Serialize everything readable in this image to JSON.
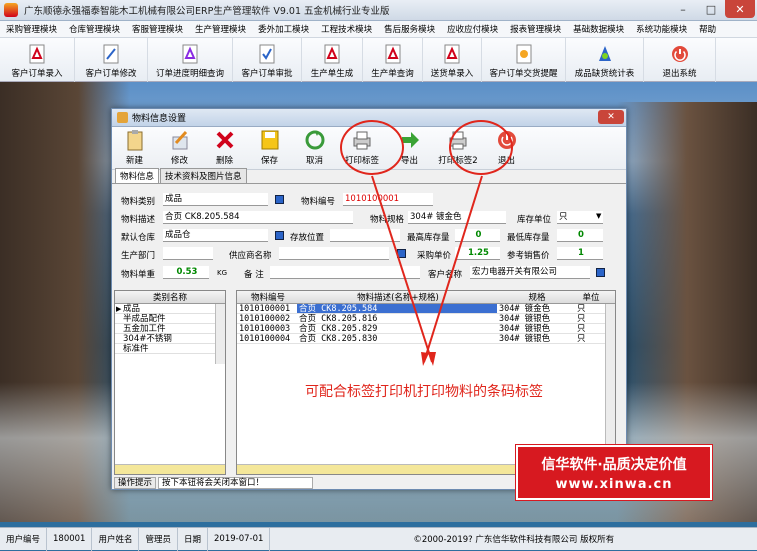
{
  "window": {
    "title": "广东顺德永强福泰智能木工机械有限公司ERP生产管理软件  V9.01 五金机械行业专业版",
    "min": "–",
    "max": "□",
    "close": "✕"
  },
  "menu": [
    "采购管理模块",
    "仓库管理模块",
    "客服管理模块",
    "生产管理模块",
    "委外加工模块",
    "工程技术模块",
    "售后服务模块",
    "应收应付模块",
    "报表管理模块",
    "基础数据模块",
    "系统功能模块",
    "帮助"
  ],
  "toolbar": [
    {
      "label": "客户订单录入",
      "icon": "pdf-icon"
    },
    {
      "label": "客户订单修改",
      "icon": "edit-doc-icon"
    },
    {
      "label": "订单进度明细查询",
      "icon": "pdf-icon"
    },
    {
      "label": "客户订单审批",
      "icon": "approve-icon"
    },
    {
      "label": "生产单生成",
      "icon": "pdf-icon"
    },
    {
      "label": "生产单查询",
      "icon": "pdf-icon"
    },
    {
      "label": "送货单录入",
      "icon": "pdf-icon"
    },
    {
      "label": "客户订单交货提醒",
      "icon": "remind-icon"
    },
    {
      "label": "成品缺货统计表",
      "icon": "stats-icon"
    },
    {
      "label": "退出系统",
      "icon": "exit-icon"
    }
  ],
  "dialog": {
    "title": "物料信息设置",
    "close": "✕",
    "buttons": [
      {
        "label": "新建",
        "icon": "clipboard-icon"
      },
      {
        "label": "修改",
        "icon": "edit-icon"
      },
      {
        "label": "删除",
        "icon": "delete-icon"
      },
      {
        "label": "保存",
        "icon": "save-icon"
      },
      {
        "label": "取消",
        "icon": "cancel-icon"
      },
      {
        "label": "打印标签",
        "icon": "printer-icon"
      },
      {
        "label": "导出",
        "icon": "export-icon"
      },
      {
        "label": "打印标签2",
        "icon": "printer-icon"
      },
      {
        "label": "退出",
        "icon": "exit-icon"
      }
    ],
    "tabs": [
      "物料信息",
      "技术资料及图片信息"
    ],
    "form": {
      "category_label": "物料类别",
      "category": "成品",
      "code_label": "物料编号",
      "code": "1010100001",
      "desc_label": "物料描述",
      "desc": "合页 CK8.205.584",
      "spec_label": "物料规格",
      "spec": "304# 镀金色",
      "unit_label": "库存单位",
      "unit": "只",
      "warehouse_label": "默认仓库",
      "warehouse": "成品仓",
      "location_label": "存放位置",
      "location": "",
      "max_label": "最高库存量",
      "max": "0",
      "min_label": "最低库存量",
      "min": "0",
      "dept_label": "生产部门",
      "dept": "",
      "supplier_label": "供应商名称",
      "supplier": "",
      "price_label": "采购单价",
      "price": "1.25",
      "ref_label": "参考销售价",
      "ref": "1",
      "weight_label": "物料单重",
      "weight": "0.53",
      "weight_unit": "KG",
      "note_label": "备  注",
      "note": "",
      "customer_label": "客户名称",
      "customer": "宏力电器开关有限公司"
    },
    "cat_header": "类别名称",
    "categories": [
      "成品",
      "半成品配件",
      "五金加工件",
      "304#不锈钢",
      "标准件"
    ],
    "mat_headers": [
      "物料编号",
      "物料描述(名称+规格)",
      "规格",
      "单位"
    ],
    "materials": [
      [
        "1010100001",
        "合页 CK8.205.584",
        "304# 镀金色",
        "只"
      ],
      [
        "1010100002",
        "合页 CK8.205.816",
        "304# 镀银色",
        "只"
      ],
      [
        "1010100003",
        "合页 CK8.205.829",
        "304# 镀银色",
        "只"
      ],
      [
        "1010100004",
        "合页 CK8.205.830",
        "304# 镀银色",
        "只"
      ]
    ],
    "hint_label": "操作提示",
    "hint": "按下本钮将会关闭本窗口！"
  },
  "annotation": "可配合标签打印机打印物料的条码标签",
  "promo": {
    "line1": "信华软件·品质决定价值",
    "line2": "www.xinwa.cn"
  },
  "statusbar": {
    "user_no_label": "用户编号",
    "user_no": "180001",
    "user_name_label": "用户姓名",
    "user_name": "管理员",
    "date_label": "日期",
    "date": "2019-07-01",
    "copyright": "©2000-2019?  广东信华软件科技有限公司  版权所有"
  },
  "colors": {
    "accent": "#3b6fd1",
    "annotation": "#e0261c",
    "promo": "#d71920"
  }
}
